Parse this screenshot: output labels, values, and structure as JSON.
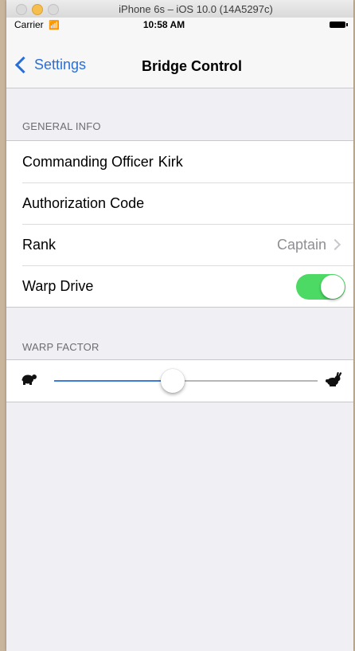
{
  "simulator": {
    "title": "iPhone 6s – iOS 10.0 (14A5297c)"
  },
  "statusbar": {
    "carrier": "Carrier",
    "time": "10:58 AM"
  },
  "navbar": {
    "back_label": "Settings",
    "title": "Bridge Control"
  },
  "general_info": {
    "header": "GENERAL INFO",
    "commanding_officer_label": "Commanding Officer",
    "commanding_officer_value": "Kirk",
    "authorization_code_label": "Authorization Code",
    "rank_label": "Rank",
    "rank_value": "Captain",
    "warp_drive_label": "Warp Drive",
    "warp_drive_on": true
  },
  "warp_factor": {
    "header": "WARP FACTOR",
    "slider_value": 0.45
  },
  "colors": {
    "accent": "#2a6fd6",
    "switch_on": "#4cd964"
  }
}
